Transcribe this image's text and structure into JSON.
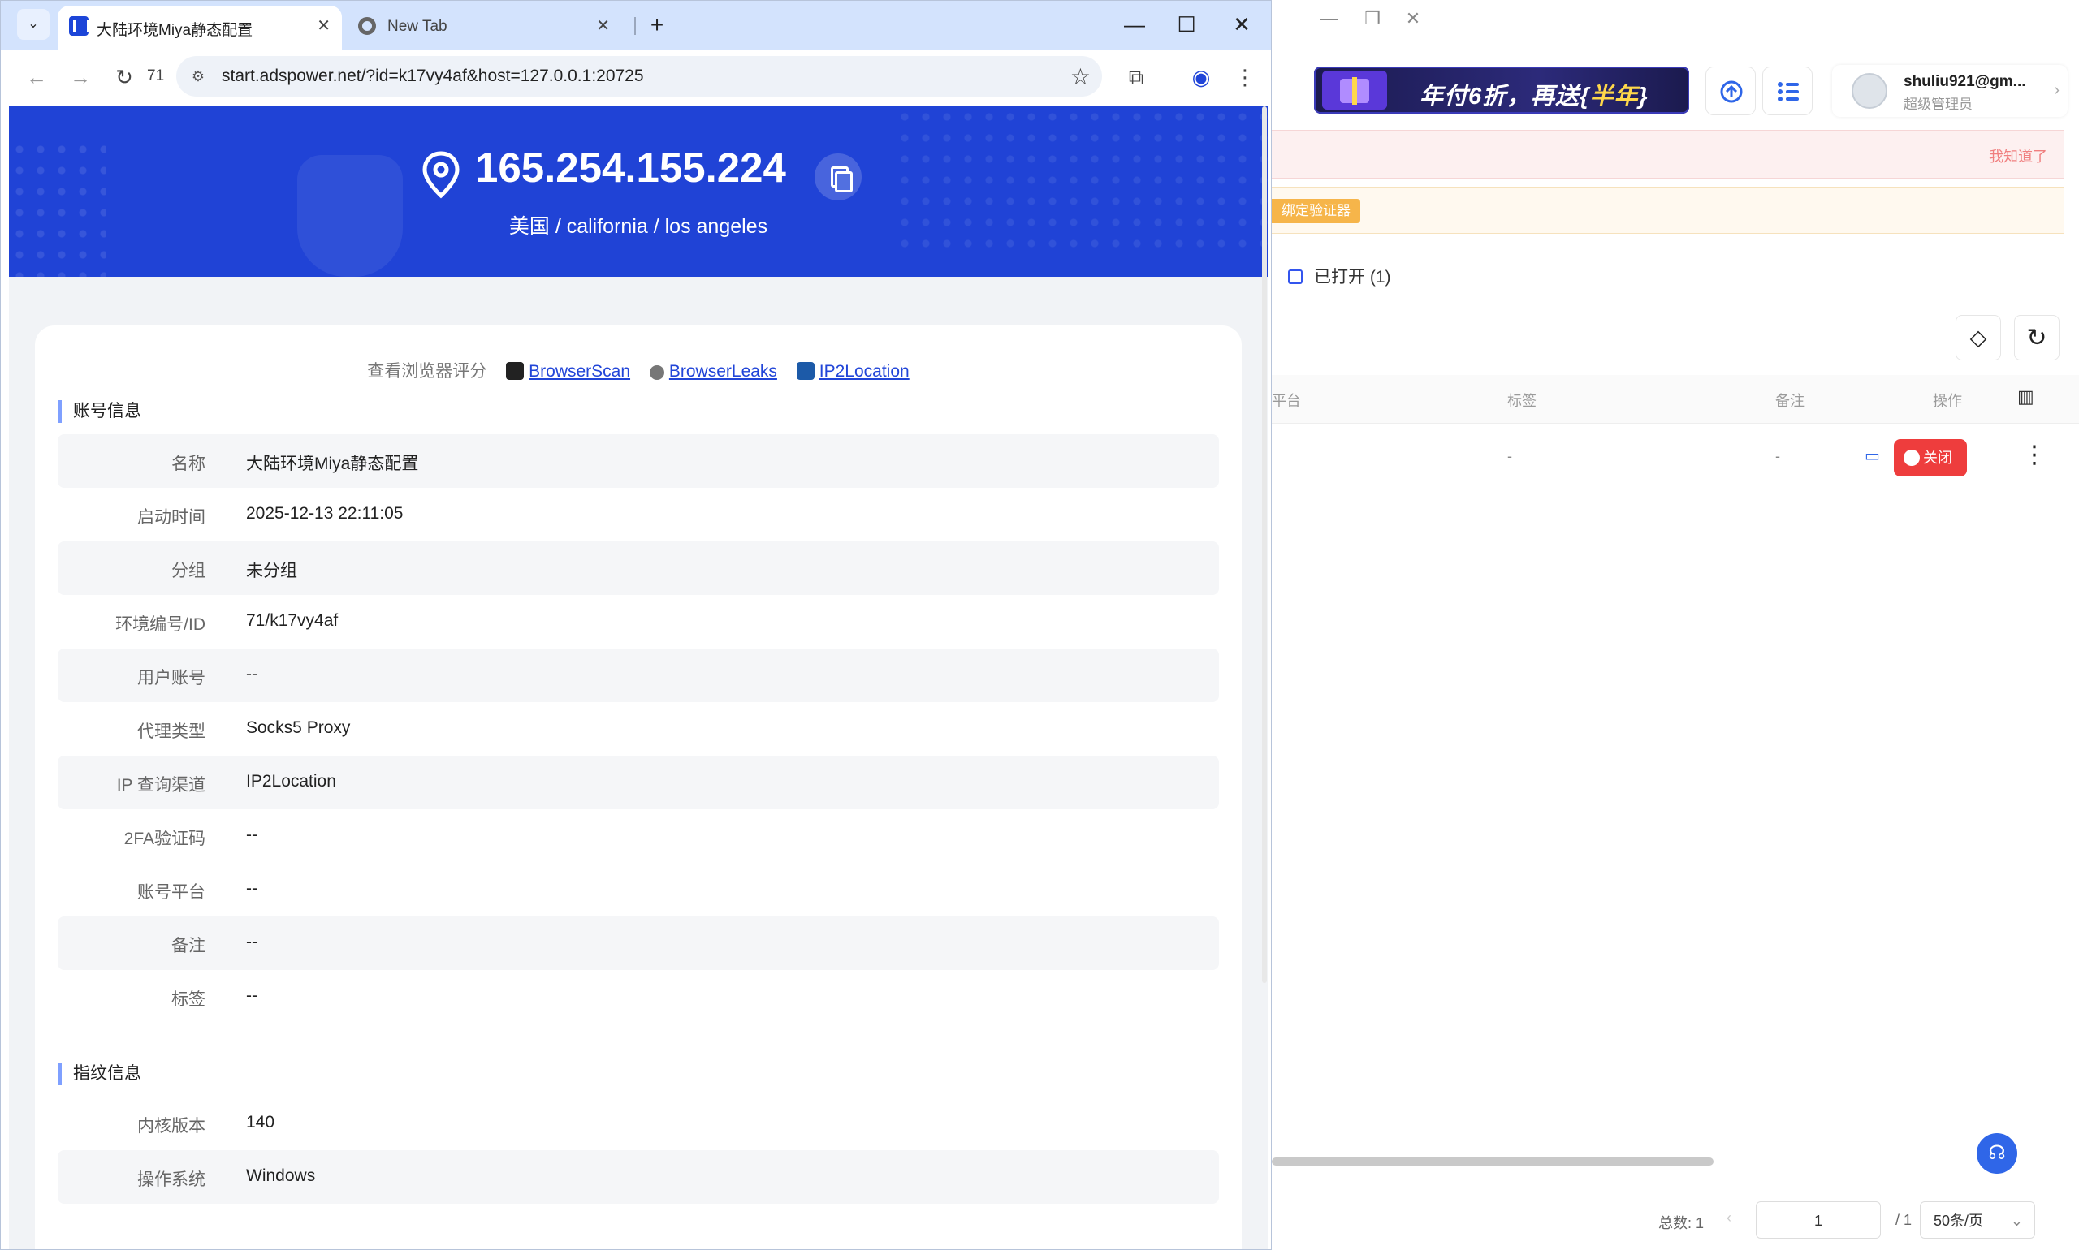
{
  "bg_app": {
    "promo_text": "年付6折，再送",
    "promo_highlight": "半年",
    "user_name": "shuliu921@gm...",
    "user_role": "超级管理员",
    "notice_link": "我知道了",
    "bind_button": "绑定验证器",
    "opened_filter": "已打开 (1)",
    "columns": [
      "平台",
      "标签",
      "备注",
      "操作"
    ],
    "row": {
      "tag": "-",
      "note": "-",
      "close_label": "关闭"
    },
    "pager": {
      "total": "总数: 1",
      "page": "1",
      "of": "/ 1",
      "size": "50条/页"
    }
  },
  "browser": {
    "tabs": [
      {
        "title": "大陆环境Miya静态配置"
      },
      {
        "title": "New Tab"
      }
    ],
    "reload_count": "71",
    "url": "start.adspower.net/?id=k17vy4af&host=127.0.0.1:20725"
  },
  "page": {
    "ip": "165.254.155.224",
    "location": "美国 / california / los angeles",
    "score_label": "查看浏览器评分",
    "score_links": [
      "BrowserScan",
      "BrowserLeaks",
      "IP2Location"
    ],
    "section_account": "账号信息",
    "account_rows": [
      {
        "k": "名称",
        "v": "大陆环境Miya静态配置"
      },
      {
        "k": "启动时间",
        "v": "2025-12-13 22:11:05"
      },
      {
        "k": "分组",
        "v": "未分组"
      },
      {
        "k": "环境编号/ID",
        "v": "71/k17vy4af"
      },
      {
        "k": "用户账号",
        "v": "--"
      },
      {
        "k": "代理类型",
        "v": "Socks5 Proxy"
      },
      {
        "k": "IP 查询渠道",
        "v": "IP2Location"
      },
      {
        "k": "2FA验证码",
        "v": "--"
      },
      {
        "k": "账号平台",
        "v": "--"
      },
      {
        "k": "备注",
        "v": "--"
      },
      {
        "k": "标签",
        "v": "--"
      }
    ],
    "section_fingerprint": "指纹信息",
    "fingerprint_rows": [
      {
        "k": "内核版本",
        "v": "140"
      },
      {
        "k": "操作系统",
        "v": "Windows"
      }
    ]
  },
  "colors": {
    "hero": "#2043d6",
    "link": "#2145d8",
    "close": "#ee3d3d",
    "tabstrip": "#d3e3fd"
  }
}
